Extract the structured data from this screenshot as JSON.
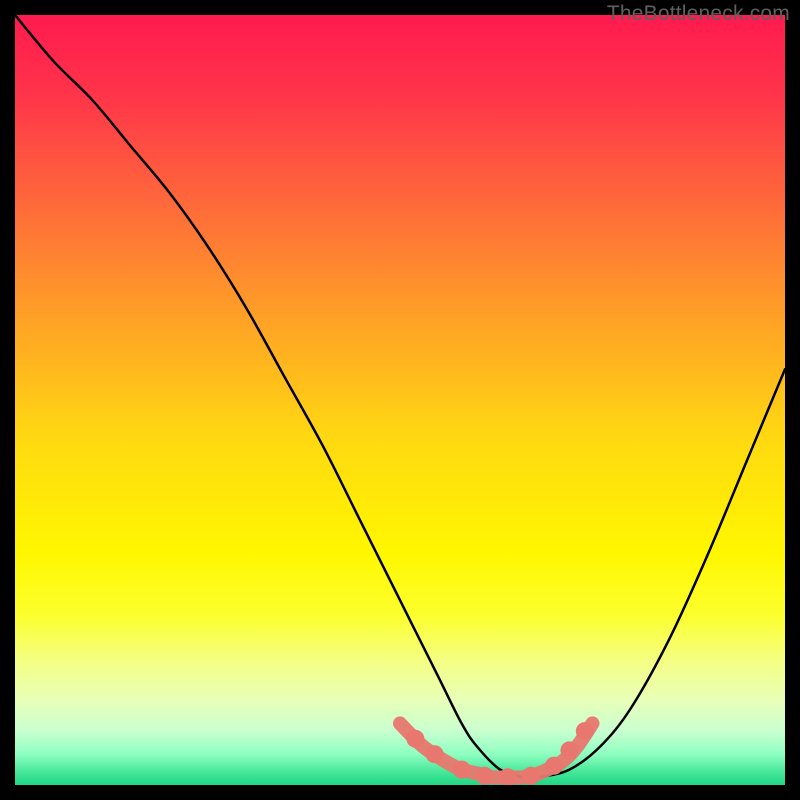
{
  "watermark": {
    "text": "TheBottleneck.com"
  },
  "colors": {
    "background": "#000000",
    "curve": "#000000",
    "highlight": "#e8776f",
    "gradient_stops": [
      {
        "offset": 0.0,
        "color": "#ff1a4f"
      },
      {
        "offset": 0.1,
        "color": "#ff334a"
      },
      {
        "offset": 0.25,
        "color": "#ff6b3a"
      },
      {
        "offset": 0.4,
        "color": "#ffa325"
      },
      {
        "offset": 0.55,
        "color": "#ffd911"
      },
      {
        "offset": 0.7,
        "color": "#fff700"
      },
      {
        "offset": 0.78,
        "color": "#fcff2e"
      },
      {
        "offset": 0.84,
        "color": "#f4ff85"
      },
      {
        "offset": 0.89,
        "color": "#e8ffb8"
      },
      {
        "offset": 0.93,
        "color": "#c8ffd0"
      },
      {
        "offset": 0.96,
        "color": "#8effc0"
      },
      {
        "offset": 0.985,
        "color": "#41e596"
      },
      {
        "offset": 1.0,
        "color": "#1ed784"
      }
    ]
  },
  "chart_data": {
    "type": "line",
    "title": "",
    "xlabel": "",
    "ylabel": "",
    "xlim": [
      0,
      100
    ],
    "ylim": [
      0,
      100
    ],
    "note": "Bottleneck-style V curve. x = relative configuration position (arbitrary 0–100), y = bottleneck % (0 = optimal at bottom, 100 = worst at top). Values estimated from pixel positions.",
    "series": [
      {
        "name": "bottleneck-curve",
        "x": [
          0,
          5,
          10,
          15,
          20,
          25,
          30,
          35,
          40,
          45,
          50,
          55,
          58,
          60,
          63,
          66,
          68,
          72,
          76,
          80,
          85,
          90,
          95,
          100
        ],
        "y": [
          100,
          94,
          89,
          83,
          77,
          70,
          62,
          53,
          44,
          34,
          24,
          14,
          8,
          5,
          2,
          1,
          1,
          2,
          5,
          10,
          19,
          30,
          42,
          54
        ]
      }
    ],
    "highlight_segment": {
      "name": "optimal-range",
      "x": [
        50,
        53,
        56,
        58,
        60,
        62,
        64,
        66,
        68,
        71,
        73,
        75
      ],
      "y": [
        8,
        5,
        3,
        2,
        1.5,
        1,
        1,
        1,
        1.5,
        3,
        5,
        8
      ]
    },
    "highlight_dots": {
      "name": "optimal-markers",
      "x": [
        52,
        54.5,
        58,
        61,
        64,
        67,
        70,
        72,
        74
      ],
      "y": [
        6,
        4,
        2,
        1.2,
        1,
        1.2,
        2.5,
        4.5,
        7
      ]
    }
  }
}
